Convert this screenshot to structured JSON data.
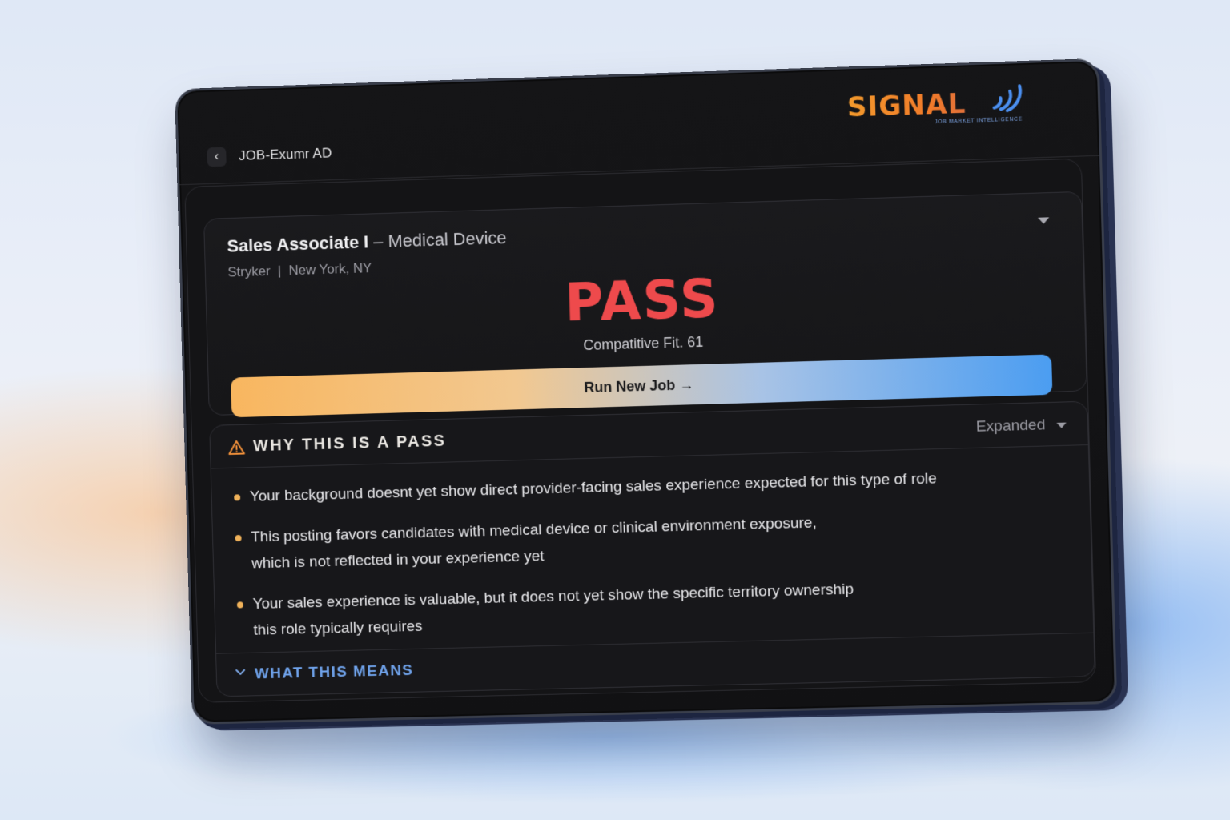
{
  "header": {
    "back_icon": "chevron-left-icon",
    "title": "JOB-Exumr AD"
  },
  "brand": {
    "name": "SIGNAL",
    "tagline": "JOB MARKET INTELLIGENCE",
    "icon": "signal-waves-icon",
    "colors": {
      "wordmark": "#f08a2a",
      "waves": "#4b8ff0"
    }
  },
  "job": {
    "title_role": "Sales Associate I",
    "title_dept": "– Medical Device",
    "company": "Stryker",
    "location": "New York, NY",
    "verdict": "PASS",
    "fit_label": "Compatitive Fit. 61",
    "run_button": "Run New Job →"
  },
  "why": {
    "icon": "warning-icon",
    "title": "WHY THIS IS A PASS",
    "state_label": "Expanded",
    "reasons": [
      {
        "line1": "Your background doesnt yet show direct provider-facing sales experience expected for this type of role",
        "line2": ""
      },
      {
        "line1": "This posting favors candidates with medical device or clinical environment exposure,",
        "line2": "which is not reflected in your experience yet"
      },
      {
        "line1": "Your sales experience is valuable, but it does not yet show the specific territory ownership",
        "line2": "this role typically requires"
      }
    ]
  },
  "means": {
    "icon": "chevron-down-icon",
    "title": "WHAT THIS MEANS"
  },
  "colors": {
    "verdict": "#ee4a4c",
    "accent_blue": "#6fa2ea",
    "bullet": "#f0b25a"
  }
}
